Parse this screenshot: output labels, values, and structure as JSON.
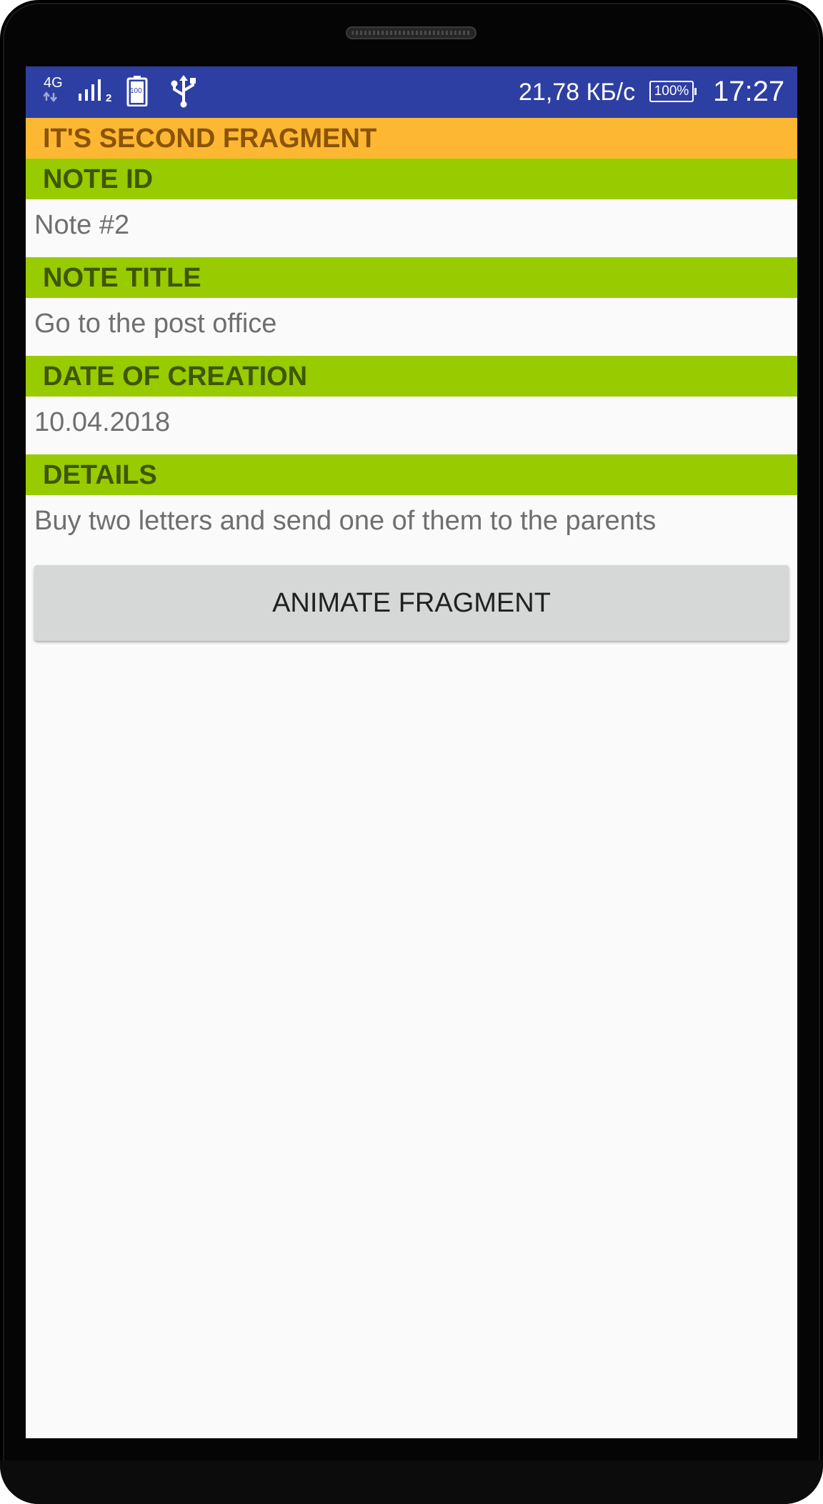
{
  "status_bar": {
    "network_type": "4G",
    "sim_slot": "2",
    "battery_icon_level": "100",
    "speed": "21,78 КБ/с",
    "battery_percent": "100%",
    "time": "17:27",
    "icons": [
      "network-4g-icon",
      "signal-icon",
      "battery-icon",
      "usb-icon"
    ],
    "background_color": "#2e3fa3"
  },
  "fragment": {
    "header": "IT'S SECOND FRAGMENT",
    "header_color": "#fdb732",
    "label_color": "#98cb00",
    "note_id_label": "NOTE ID",
    "note_id_value": "Note #2",
    "note_title_label": "NOTE TITLE",
    "note_title_value": "Go to the post office",
    "date_label": "DATE OF CREATION",
    "date_value": "10.04.2018",
    "details_label": "DETAILS",
    "details_value": "Buy two letters and send one of them to the parents"
  },
  "button": {
    "label": "ANIMATE FRAGMENT"
  }
}
